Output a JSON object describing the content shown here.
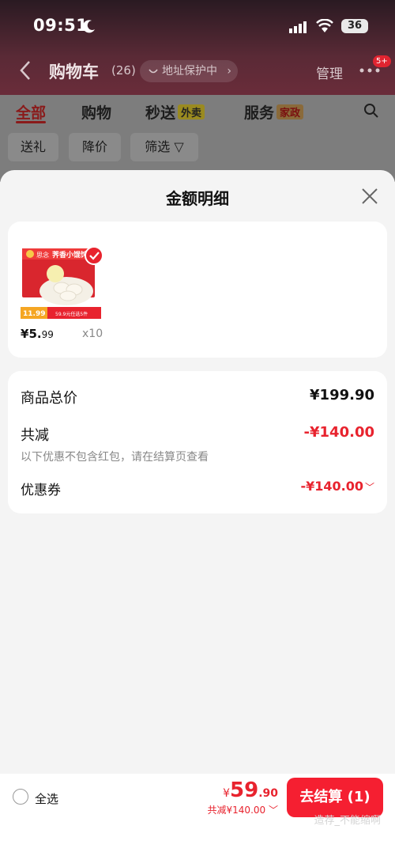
{
  "status_bar": {
    "time": "09:51",
    "battery": "36"
  },
  "nav": {
    "title": "购物车",
    "count": "(26)",
    "address_pill": "地址保护中",
    "manage": "管理",
    "more_badge": "5+"
  },
  "tabs": [
    {
      "label": "全部",
      "active": true
    },
    {
      "label": "购物",
      "active": false
    },
    {
      "label": "秒送",
      "badge": "外卖",
      "active": false
    },
    {
      "label": "服务",
      "badge": "家政",
      "active": false
    }
  ],
  "chips": [
    "送礼",
    "降价",
    "筛选 ▽"
  ],
  "sheet": {
    "title": "金额明细",
    "product": {
      "price_yen": "¥",
      "price_int": "5.",
      "price_dec": "99",
      "qty": "x10",
      "image_text": {
        "brand": "思念",
        "name": "荠香小馄饨",
        "tag": "59.9元任选5件",
        "price_tag": "11.99"
      }
    },
    "summary": {
      "total_label": "商品总价",
      "total_value": "¥199.90",
      "discount_label": "共减",
      "discount_value": "-¥140.00",
      "note": "以下优惠不包含红包，请在结算页查看",
      "coupon_label": "优惠券",
      "coupon_value": "-¥140.00"
    }
  },
  "bottom": {
    "select_all": "全选",
    "total_yen": "¥",
    "total_int": "59",
    "total_dec": ".90",
    "saved": "共减¥140.00",
    "checkout": "去结算 (1)",
    "watermark": "造荐_不能缩啊"
  },
  "colors": {
    "accent": "#f51f31",
    "discount_red": "#e8232e",
    "header_dark": "#5a2a36"
  }
}
